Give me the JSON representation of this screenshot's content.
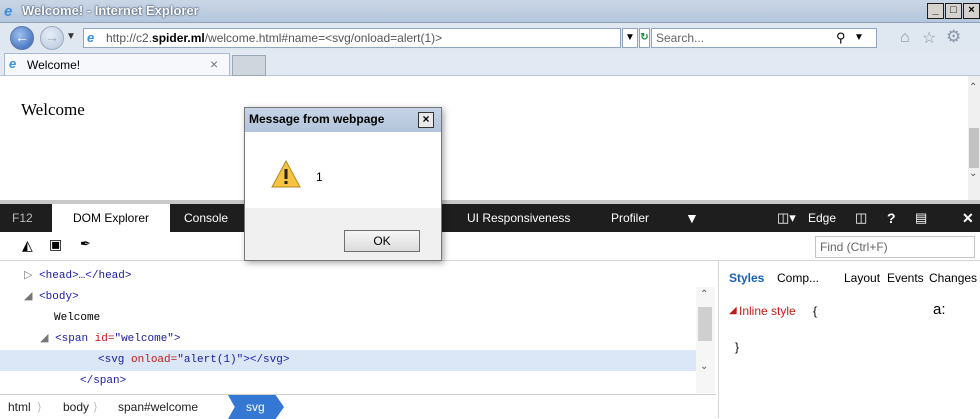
{
  "window": {
    "title": "Welcome! - Internet Explorer",
    "controls": [
      "_",
      "□",
      "×"
    ]
  },
  "navbar": {
    "url_pre": "http://c2.",
    "url_host": "spider.ml",
    "url_post": "/welcome.html#name=<svg/onload=alert(1)>",
    "search_placeholder": "Search...",
    "search_icon": "search-icon"
  },
  "tab": {
    "label": "Welcome!",
    "close": "×"
  },
  "page": {
    "heading": "Welcome"
  },
  "devtools": {
    "tabs": [
      "F12",
      "DOM Explorer",
      "Console",
      "UI Responsiveness",
      "Profiler"
    ],
    "mode": "Edge",
    "find_placeholder": "Find (Ctrl+F)",
    "dom": {
      "head": "<head>…</head>",
      "body_open": "<body>",
      "text_welcome": "Welcome",
      "span_open_tag": "<span ",
      "span_attr": "id=",
      "span_val": "\"welcome\"",
      "span_close_bracket": ">",
      "svg_tag_open": "<svg ",
      "svg_attr": "onload=",
      "svg_val": "\"alert(1)\"",
      "svg_tag_close": "></svg>",
      "span_close": "</span>"
    },
    "styles_tabs": [
      "Styles",
      "Comp...",
      "Layout",
      "Events",
      "Changes"
    ],
    "inline_style_label": "Inline style",
    "inline_open": "{",
    "inline_close": "}",
    "inline_aa": "a:",
    "breadcrumb": [
      "html",
      "body",
      "span#welcome",
      "svg"
    ]
  },
  "dialog": {
    "title": "Message from webpage",
    "message": "1",
    "ok_label": "OK"
  },
  "colors": {
    "accent": "#3478d4",
    "dev_dark": "#1e1e1e",
    "tag": "#1a1aa6",
    "attr": "#c41a16"
  }
}
